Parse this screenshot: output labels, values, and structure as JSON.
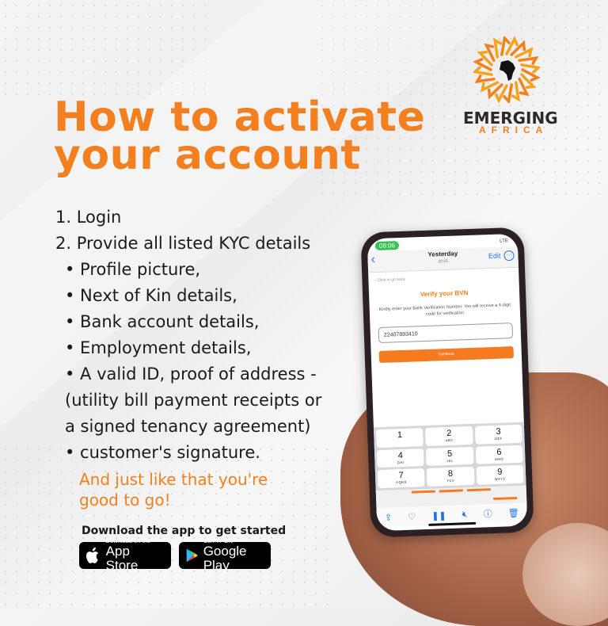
{
  "headline": {
    "line1": "How to activate",
    "line2": "your account"
  },
  "brand": {
    "name": "EMERGING",
    "sub": "AFRICA",
    "accent_color": "#f37f1e"
  },
  "steps": [
    "1.  Login",
    "2.  Provide all listed KYC details"
  ],
  "kyc_items": [
    "• Profile picture,",
    "• Next of Kin details,",
    "• Bank account details,",
    "• Employment details,",
    "• A valid ID, proof of address -",
    "(utility bill payment receipts or",
    "a signed tenancy agreement)",
    "• customer's signature."
  ],
  "tagline": {
    "line1": "And just like that you're",
    "line2": "good to go!"
  },
  "download": {
    "prompt": "Download the app to get started",
    "app_store": {
      "small": "Download on the",
      "big": "App Store"
    },
    "google_play": {
      "small": "GET IT ON",
      "big": "Google Play"
    }
  },
  "phone": {
    "time": "08:06",
    "carrier": "LTE",
    "nav": {
      "back": "‹",
      "title": "Yesterday",
      "subtitle": "22:15",
      "edit": "Edit",
      "more": "···"
    },
    "back_link": "‹  Click to go back",
    "screen_title": "Verify your BVN",
    "description": "Kindly enter your Bank Verification Number. You will receive a 4-digit code for verification",
    "bvn_value": "22407893410",
    "continue_label": "Continue",
    "keypad": [
      {
        "num": "1",
        "letters": ""
      },
      {
        "num": "2",
        "letters": "ABC"
      },
      {
        "num": "3",
        "letters": "DEF"
      },
      {
        "num": "4",
        "letters": "GHI"
      },
      {
        "num": "5",
        "letters": "JKL"
      },
      {
        "num": "6",
        "letters": "MNO"
      },
      {
        "num": "7",
        "letters": "PQRS"
      },
      {
        "num": "8",
        "letters": "TUV"
      },
      {
        "num": "9",
        "letters": "WXYZ"
      }
    ],
    "toolbar": [
      "share",
      "heart",
      "pause",
      "mute",
      "info",
      "trash"
    ]
  }
}
